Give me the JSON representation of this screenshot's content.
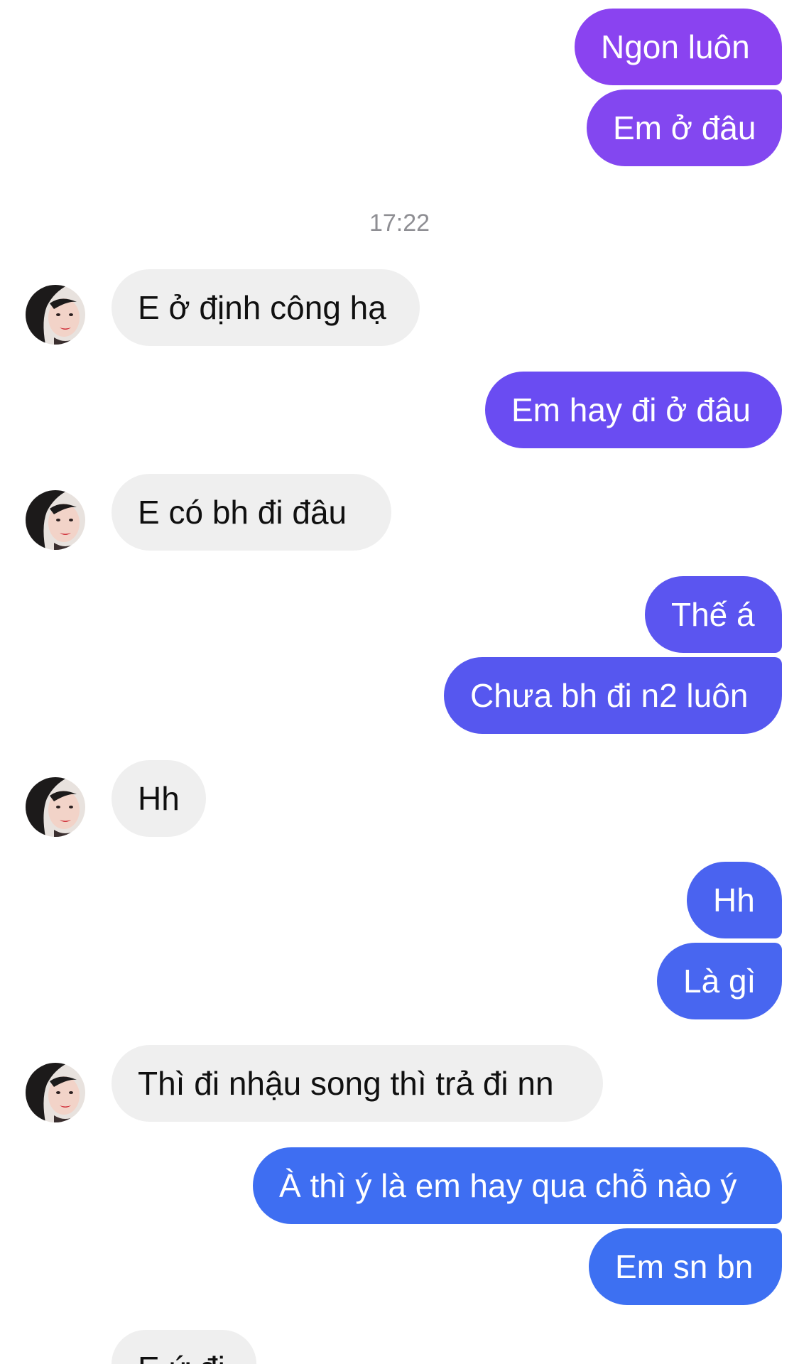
{
  "conversation": {
    "timestamp": "17:22",
    "messages": [
      {
        "side": "out",
        "text": "Ngon luôn",
        "color": "#8a43f0"
      },
      {
        "side": "out",
        "text": "Em ở đâu",
        "color": "#8347f0"
      },
      {
        "side": "in",
        "text": "E ở định công hạ"
      },
      {
        "side": "out",
        "text": "Em hay đi ở đâu",
        "color": "#6a4cf2"
      },
      {
        "side": "in",
        "text": "E có  bh đi đâu"
      },
      {
        "side": "out",
        "text": "Thế á",
        "color": "#5b55f0"
      },
      {
        "side": "out",
        "text": "Chưa bh đi n2 luôn",
        "color": "#5657ef"
      },
      {
        "side": "in",
        "text": "Hh"
      },
      {
        "side": "out",
        "text": "Hh",
        "color": "#4a63f0"
      },
      {
        "side": "out",
        "text": "Là gì",
        "color": "#4866f0"
      },
      {
        "side": "in",
        "text": "Thì đi nhậu song thì trả đi nn"
      },
      {
        "side": "out",
        "text": "À thì ý là em hay qua chỗ nào ý",
        "color": "#3e6ef2"
      },
      {
        "side": "out",
        "text": "Em sn bn",
        "color": "#3d70f2"
      },
      {
        "side": "in",
        "text": "E ứ đi"
      }
    ]
  }
}
